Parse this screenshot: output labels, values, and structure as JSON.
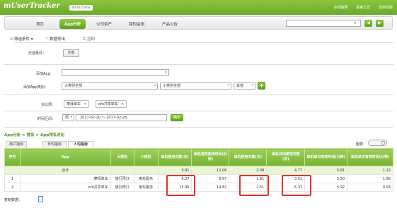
{
  "app": {
    "logo": "mUserTracker",
    "beta": "Beta Data",
    "links": [
      "在线解释",
      "联系方式",
      "回到旧版"
    ]
  },
  "nav": {
    "items": [
      "首页",
      "App分析",
      "公司资产",
      "我的监测",
      "产品公告"
    ],
    "search_placeholder": ""
  },
  "toolbar": {
    "filter": "筛选条件",
    "export": "数据导出",
    "print": "打印"
  },
  "filters": {
    "selected_label": "已选条件：",
    "selected_value": "全部",
    "add_app_label": "添加App:",
    "add_app_value": "",
    "category_label": "添加App类别：",
    "category_value": "大类别全部",
    "subcategory_value": "小类别全部",
    "total_value": "总值",
    "compare_label": "对比项：",
    "compare_items": [
      "摩拜单车",
      "ofo共享单车"
    ],
    "time_label": "时间区间：",
    "time_unit": "周",
    "date_range": "2017-02-20 ～ 2017-02-26",
    "confirm": "确定"
  },
  "breadcrumb": "App分析 > 排名 > App排名对比",
  "chart_toggle_label": "图表:",
  "tabs": [
    "用户指标",
    "日均指标",
    "人均指标"
  ],
  "table": {
    "headers": [
      "序号",
      "App",
      "大类别",
      "小类别",
      "单机使用次数(次)",
      "单机有效使用时间(分钟)",
      "单机使用天数(天)",
      "单机日均使用次数(次)",
      "单机单日有效时间(分钟)",
      "单机单次有效时间(分钟)"
    ],
    "total": {
      "label": "合计",
      "values": [
        "9.91",
        "12.06",
        "2.08",
        "4.77",
        "5.81",
        "1.22"
      ]
    },
    "rows": [
      {
        "index": "1",
        "app": "摩拜单车",
        "cat": "旅行预订",
        "sub": "用车服务",
        "values": [
          "6.37",
          "9.97",
          "1.81",
          "3.51",
          "5.50",
          "1.56"
        ]
      },
      {
        "index": "2",
        "app": "ofo共享单车",
        "cat": "旅行预订",
        "sub": "用车服务",
        "values": [
          "15.96",
          "14.82",
          "2.51",
          "6.37",
          "5.92",
          "0.93"
        ]
      }
    ]
  },
  "copy_label": "复制数据："
}
